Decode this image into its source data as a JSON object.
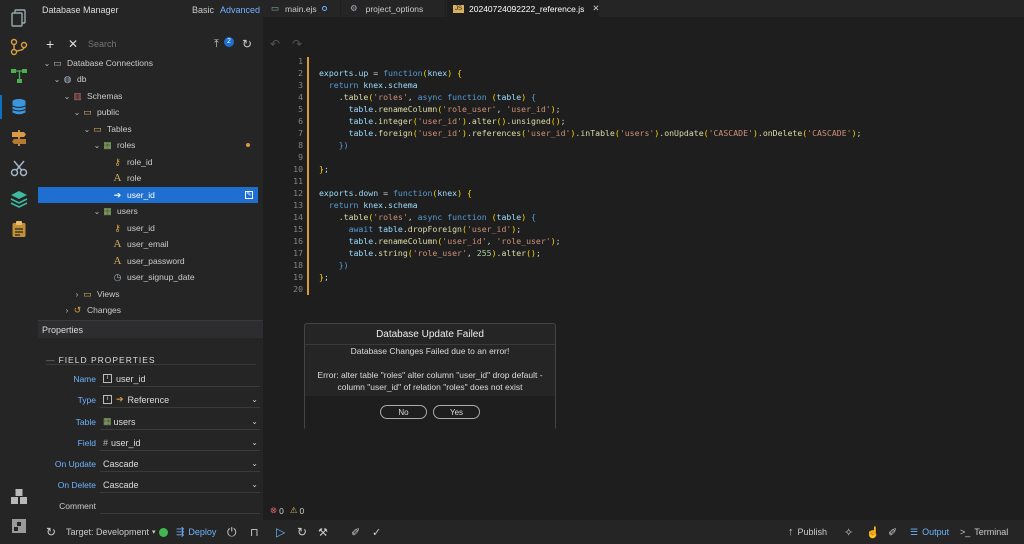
{
  "sidebar": {
    "title": "Database Manager",
    "mode_basic": "Basic",
    "mode_advanced": "Advanced",
    "search_placeholder": "Search",
    "badge": "2",
    "tree": {
      "connections": "Database Connections",
      "db": "db",
      "schemas": "Schemas",
      "public": "public",
      "tables": "Tables",
      "roles": "roles",
      "roles_cols": [
        "role_id",
        "role",
        "user_id"
      ],
      "users": "users",
      "users_cols": [
        "user_id",
        "user_email",
        "user_password",
        "user_signup_date"
      ],
      "views": "Views",
      "changes": "Changes"
    }
  },
  "properties": {
    "title": "Properties",
    "section": "FIELD PROPERTIES",
    "name_label": "Name",
    "name_value": "user_id",
    "type_label": "Type",
    "type_value": "Reference",
    "table_label": "Table",
    "table_value": "users",
    "field_label": "Field",
    "field_value": "user_id",
    "onupdate_label": "On Update",
    "onupdate_value": "Cascade",
    "ondelete_label": "On Delete",
    "ondelete_value": "Cascade",
    "comment_label": "Comment"
  },
  "tabs": [
    "main.ejs",
    "project_options",
    "20240724092222_reference.js"
  ],
  "editor": {
    "line_numbers": [
      "1",
      "2",
      "3",
      "4",
      "5",
      "6",
      "7",
      "8",
      "9",
      "10",
      "11",
      "12",
      "13",
      "14",
      "15",
      "16",
      "17",
      "18",
      "19",
      "20"
    ]
  },
  "dialog": {
    "title": "Database Update Failed",
    "subtitle": "Database Changes Failed due to an error!",
    "error_line1": "Error: alter table \"roles\" alter column \"user_id\" drop default -",
    "error_line2": "column \"user_id\" of relation \"roles\" does not exist",
    "no_label": "No",
    "yes_label": "Yes"
  },
  "problems": {
    "errors": "0",
    "warnings": "0"
  },
  "status": {
    "target": "Target: Development",
    "deploy": "Deploy",
    "publish": "Publish",
    "output": "Output",
    "terminal": "Terminal"
  },
  "colors": {
    "accent": "#1f6fd1",
    "link": "#6eb4ff",
    "deploy_dot": "#3fb950"
  }
}
